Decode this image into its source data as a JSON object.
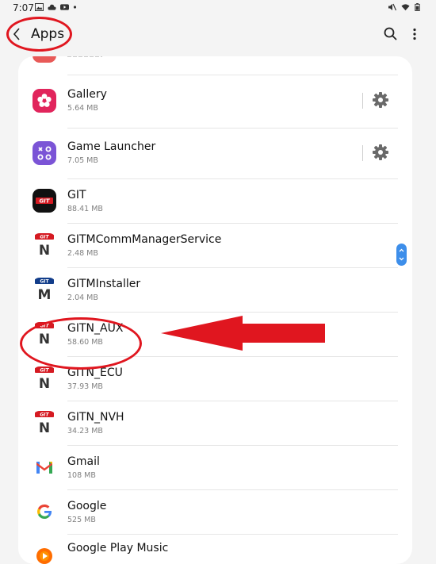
{
  "status_bar": {
    "time": "7:07",
    "left_icons": [
      "image-icon",
      "cloud-icon",
      "youtube-icon",
      "dot-icon"
    ],
    "right_icons": [
      "mute-icon",
      "wifi-icon",
      "battery-icon"
    ]
  },
  "header": {
    "back_icon": "chevron-left-icon",
    "title": "Apps",
    "search_icon": "search-icon",
    "more_icon": "more-vertical-icon"
  },
  "apps": [
    {
      "name": "Gallery",
      "size": "5.64 MB",
      "icon": "gallery-icon",
      "has_settings": true
    },
    {
      "name": "Game Launcher",
      "size": "7.05 MB",
      "icon": "game-launcher-icon",
      "has_settings": true
    },
    {
      "name": "GIT",
      "size": "88.41 MB",
      "icon": "git-icon",
      "has_settings": false
    },
    {
      "name": "GITMCommManagerService",
      "size": "2.48 MB",
      "icon": "gitn-icon",
      "has_settings": false
    },
    {
      "name": "GITMInstaller",
      "size": "2.04 MB",
      "icon": "gitm-icon",
      "has_settings": false
    },
    {
      "name": "GITN_AUX",
      "size": "58.60 MB",
      "icon": "gitn-icon",
      "has_settings": false
    },
    {
      "name": "GITN_ECU",
      "size": "37.93 MB",
      "icon": "gitn-icon",
      "has_settings": false
    },
    {
      "name": "GITN_NVH",
      "size": "34.23 MB",
      "icon": "gitn-icon",
      "has_settings": false
    },
    {
      "name": "Gmail",
      "size": "108 MB",
      "icon": "gmail-icon",
      "has_settings": false
    },
    {
      "name": "Google",
      "size": "525 MB",
      "icon": "google-icon",
      "has_settings": false
    },
    {
      "name": "Google Play Music",
      "size": "",
      "icon": "play-music-icon",
      "has_settings": false
    }
  ],
  "annotation_colors": {
    "highlight": "#e0161f"
  },
  "accent": "#3d8eea"
}
